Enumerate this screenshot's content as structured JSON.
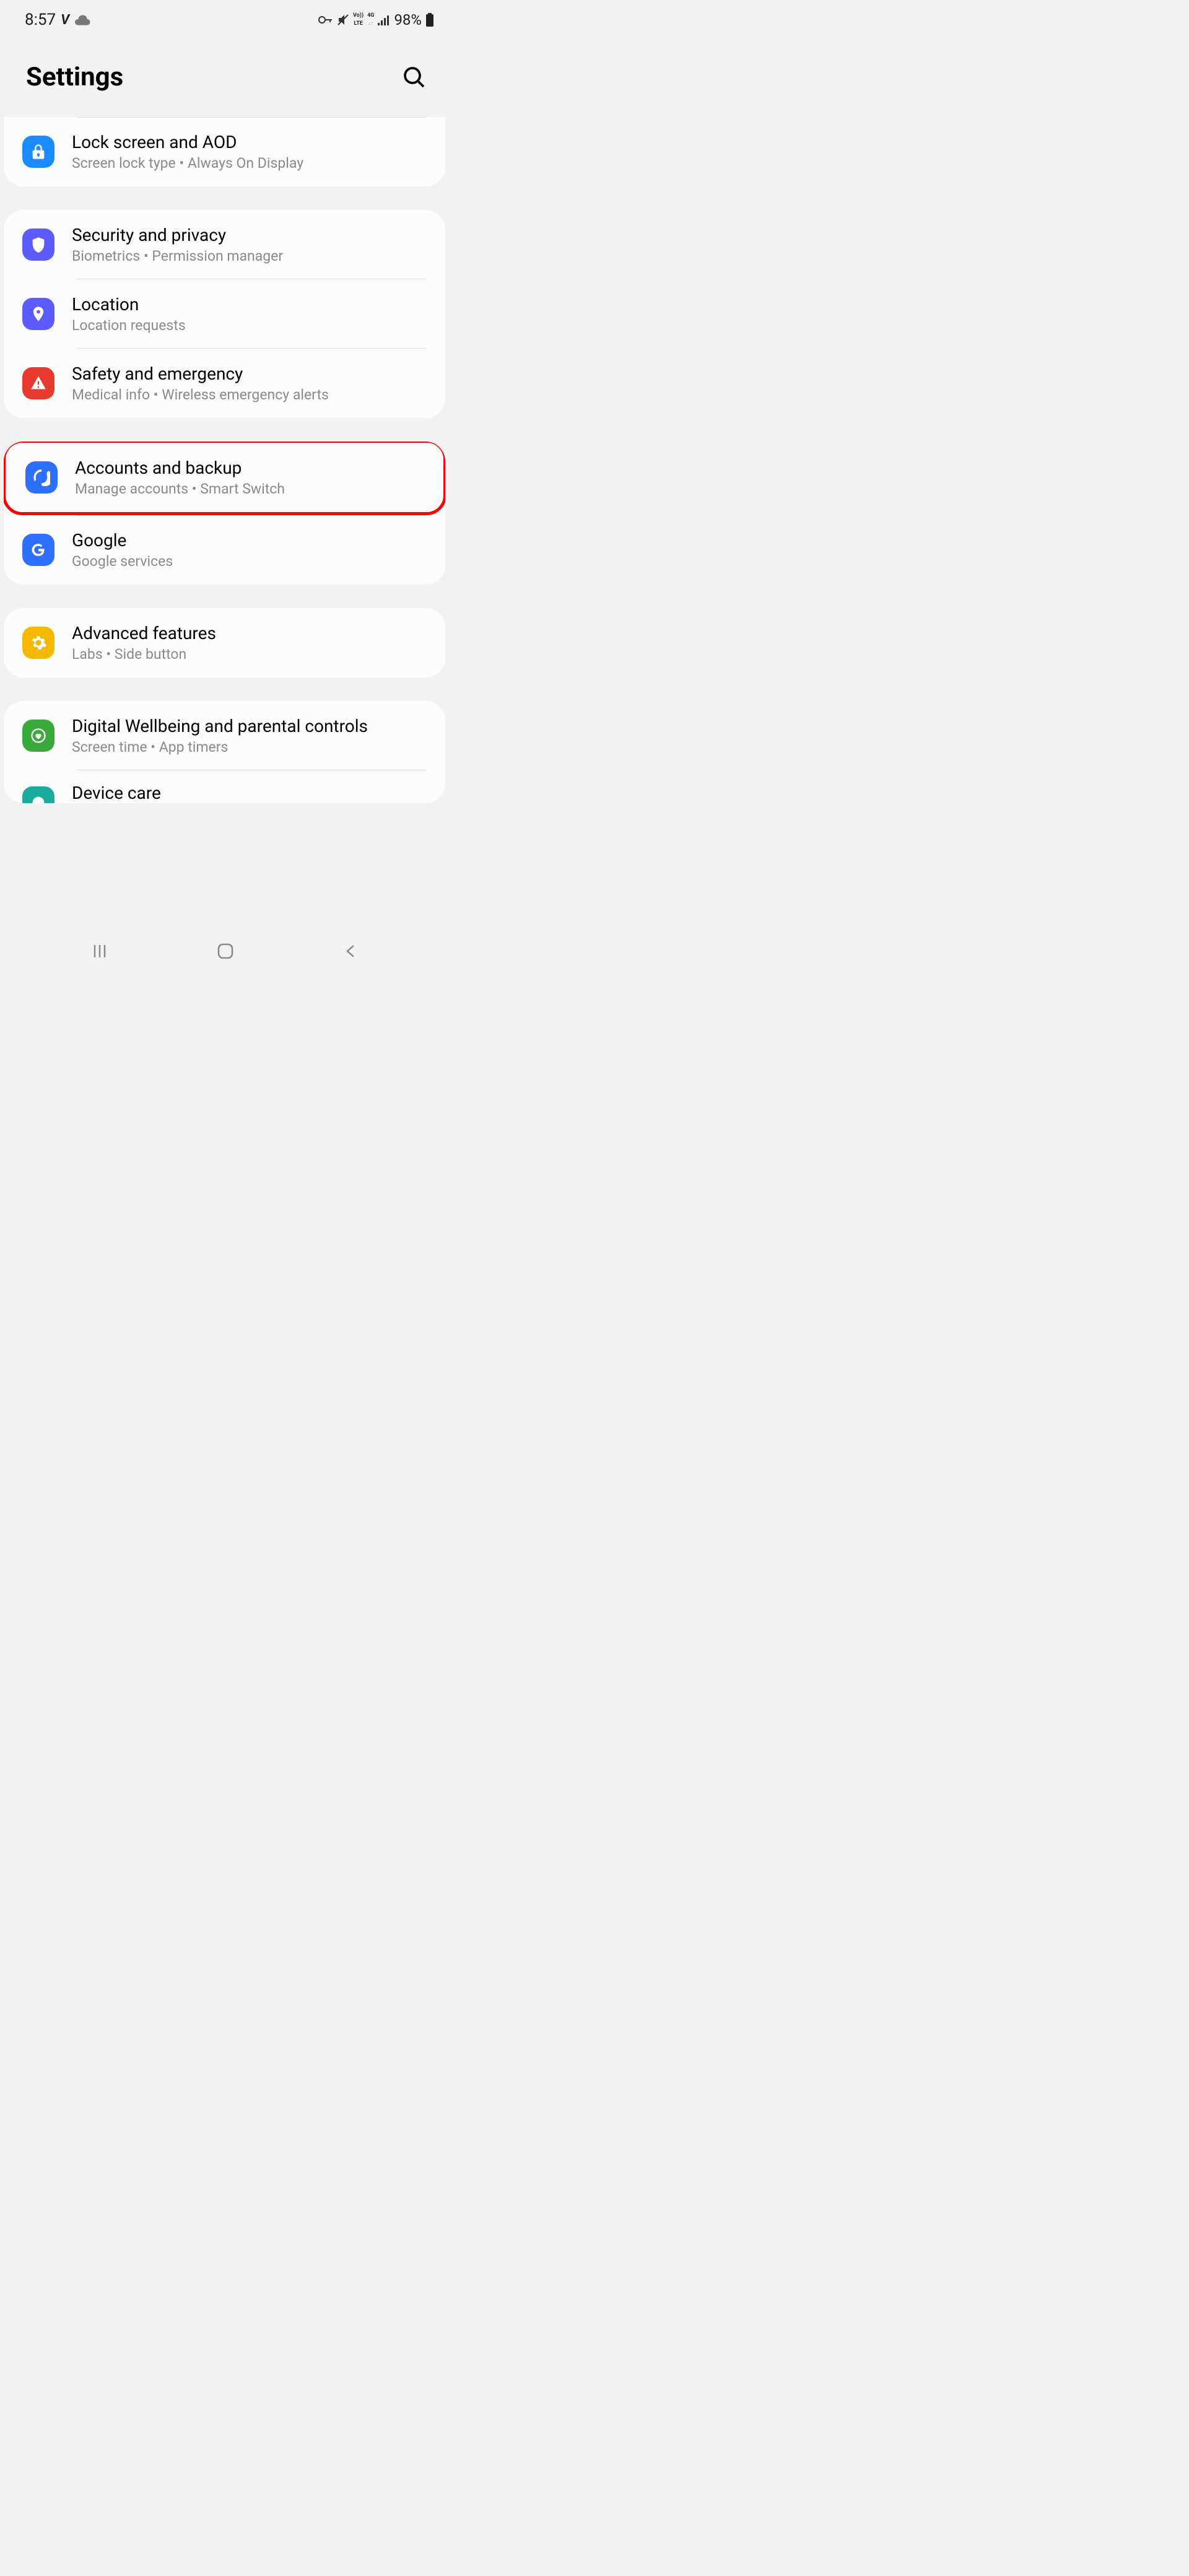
{
  "status": {
    "time": "8:57",
    "battery": "98%"
  },
  "header": {
    "title": "Settings"
  },
  "groups": [
    {
      "items": [
        {
          "id": "lock-screen",
          "title": "Lock screen and AOD",
          "subtitle": "Screen lock type  •  Always On Display",
          "icon": "lock",
          "iconBg": "#1a8cff"
        }
      ]
    },
    {
      "items": [
        {
          "id": "security",
          "title": "Security and privacy",
          "subtitle": "Biometrics  •  Permission manager",
          "icon": "shield",
          "iconBg": "#5b5bff"
        },
        {
          "id": "location",
          "title": "Location",
          "subtitle": "Location requests",
          "icon": "pin",
          "iconBg": "#5b5bff"
        },
        {
          "id": "safety",
          "title": "Safety and emergency",
          "subtitle": "Medical info  •  Wireless emergency alerts",
          "icon": "alert",
          "iconBg": "#e63b2e"
        }
      ]
    },
    {
      "items": [
        {
          "id": "accounts",
          "title": "Accounts and backup",
          "subtitle": "Manage accounts  •  Smart Switch",
          "icon": "sync",
          "iconBg": "#2e6fff",
          "highlighted": true
        },
        {
          "id": "google",
          "title": "Google",
          "subtitle": "Google services",
          "icon": "google",
          "iconBg": "#2e6fff"
        }
      ]
    },
    {
      "items": [
        {
          "id": "advanced",
          "title": "Advanced features",
          "subtitle": "Labs  •  Side button",
          "icon": "gear",
          "iconBg": "#f5b800"
        }
      ]
    },
    {
      "items": [
        {
          "id": "wellbeing",
          "title": "Digital Wellbeing and parental controls",
          "subtitle": "Screen time  •  App timers",
          "icon": "heart-circle",
          "iconBg": "#3aab3a"
        },
        {
          "id": "device-care",
          "title": "Device care",
          "subtitle": "",
          "icon": "device",
          "iconBg": "#1aab9c",
          "partial": true
        }
      ]
    }
  ]
}
